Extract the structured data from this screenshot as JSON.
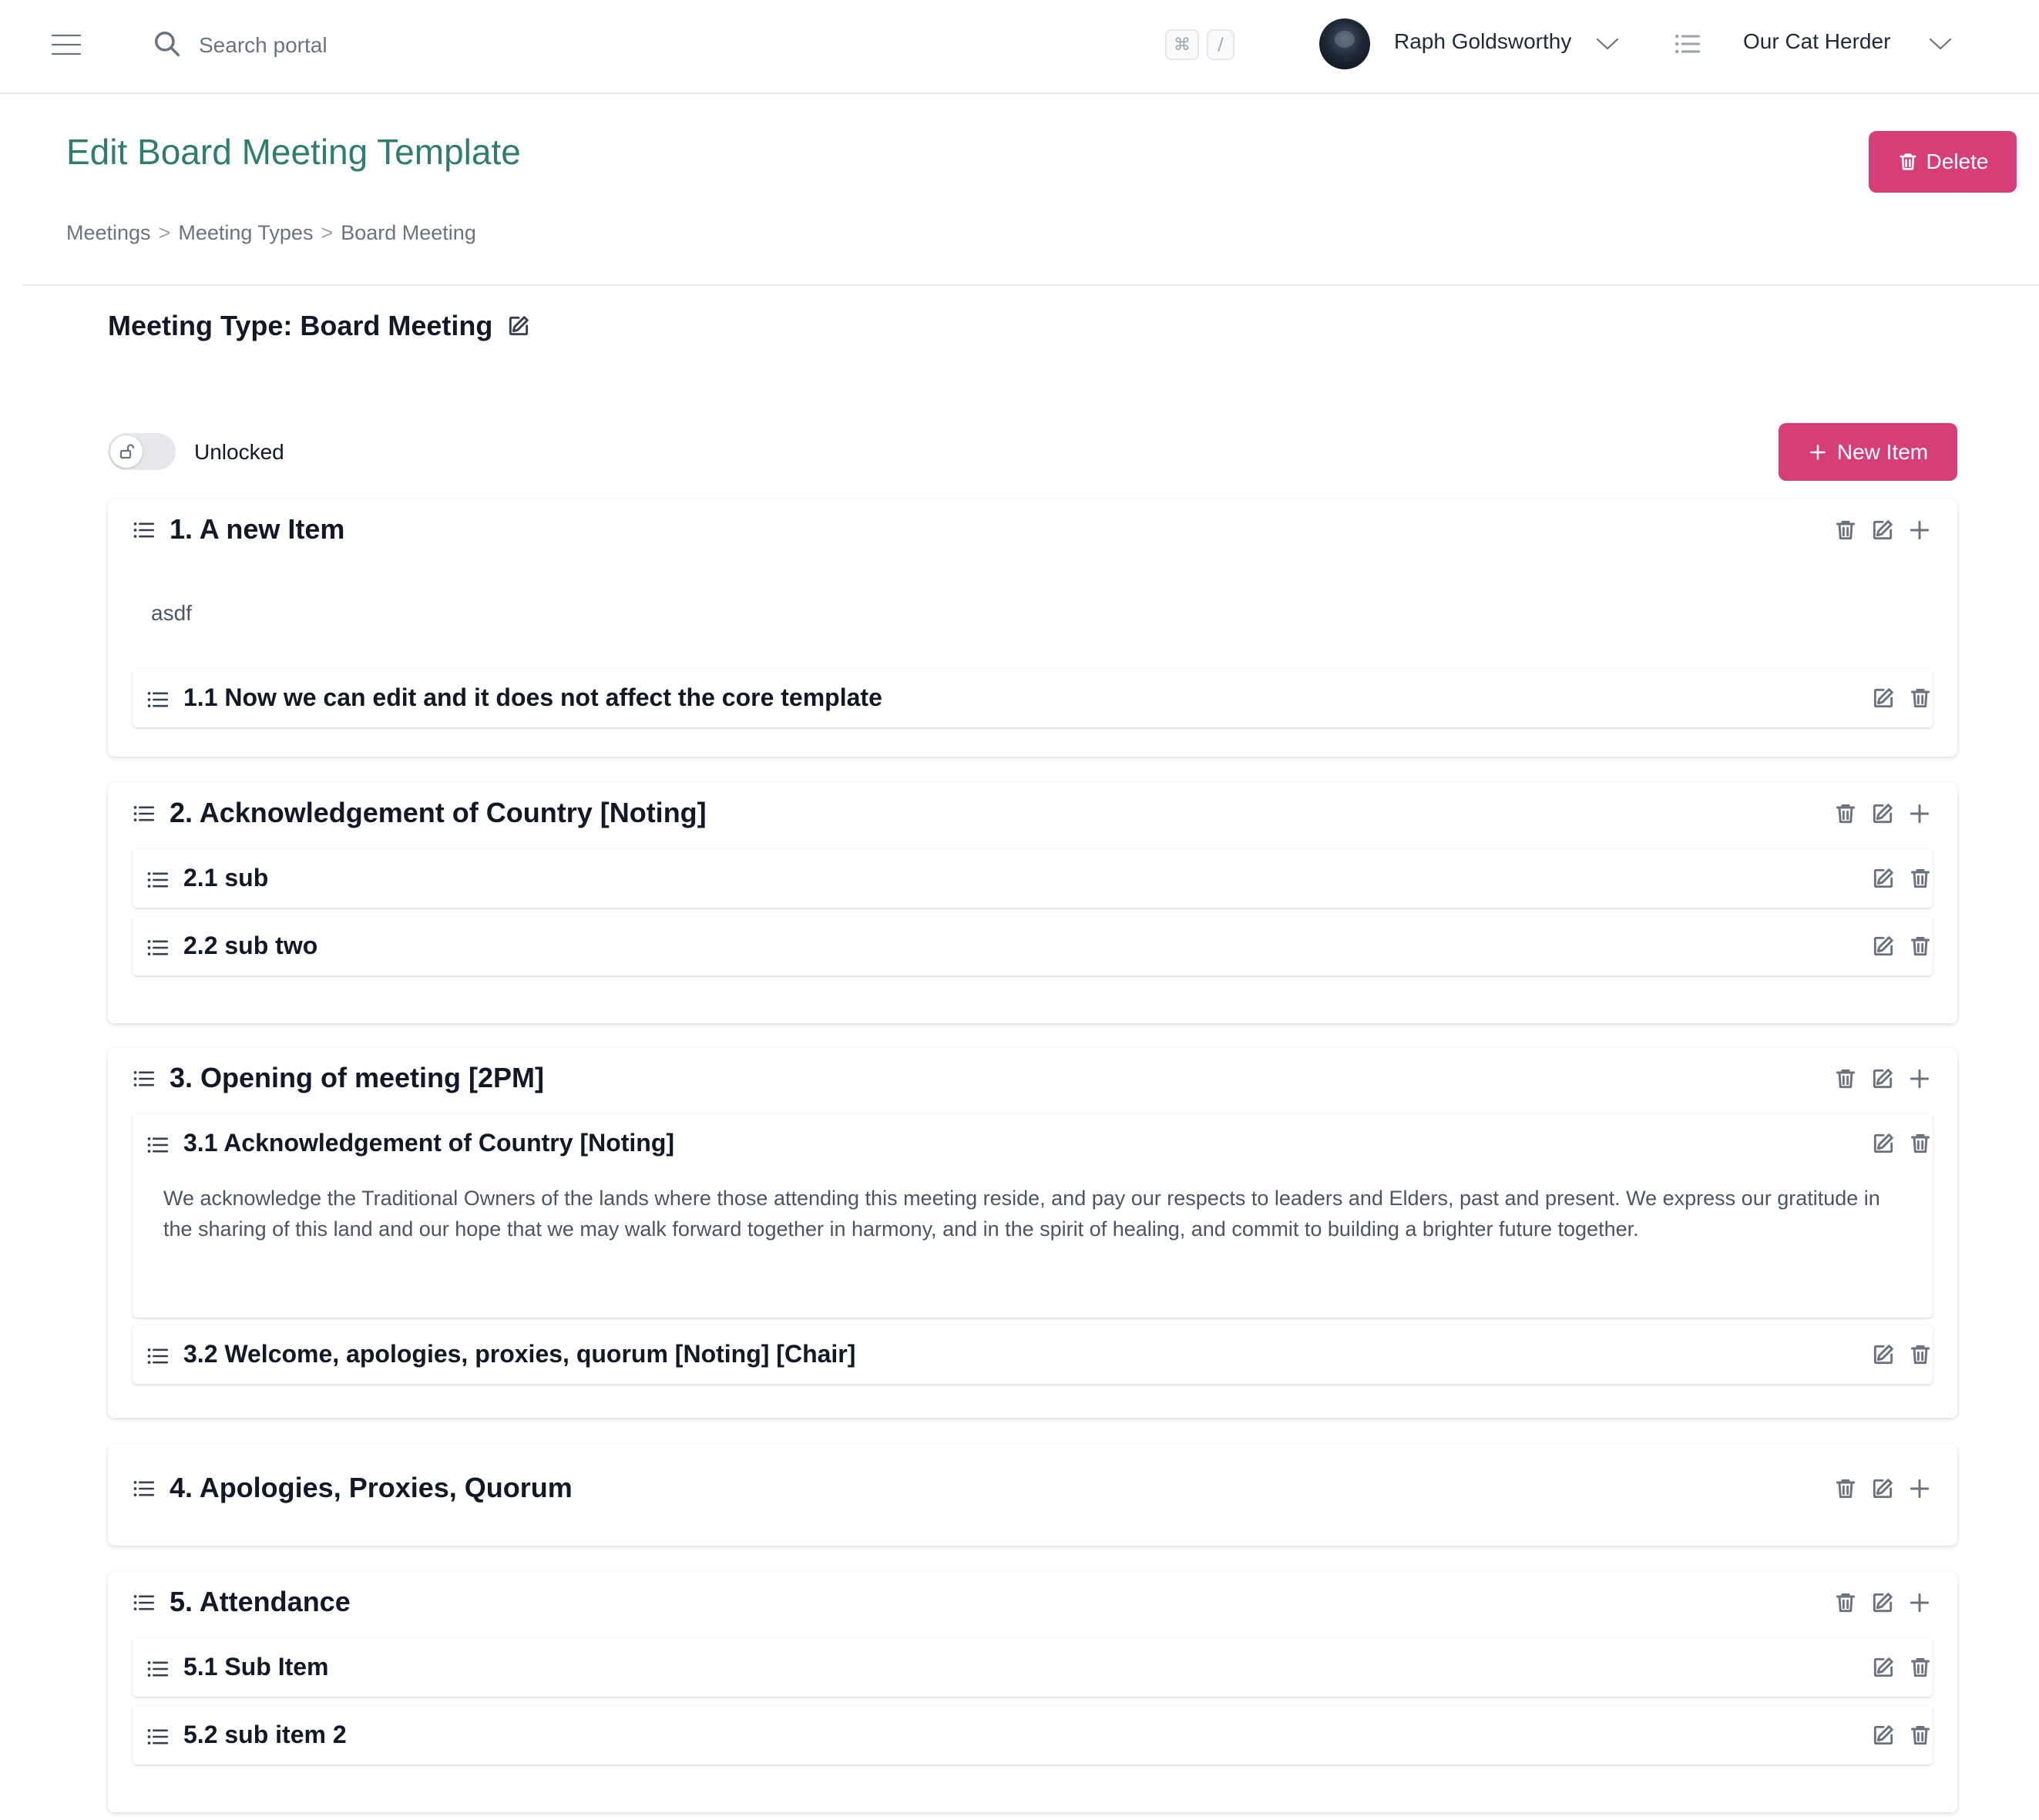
{
  "topbar": {
    "menu_icon": "hamburger-icon",
    "search_icon": "search-icon",
    "search_placeholder": "Search portal",
    "shortcut_cmd": "⌘",
    "shortcut_key": "/",
    "user_name": "Raph Goldsworthy",
    "org_icon": "list-icon",
    "org_name": "Our Cat Herder"
  },
  "page": {
    "title": "Edit Board Meeting Template",
    "delete_label": "Delete",
    "breadcrumb": [
      "Meetings",
      ">",
      "Meeting Types",
      ">",
      "Board Meeting"
    ]
  },
  "meeting_type": {
    "title": "Meeting Type: Board Meeting"
  },
  "toolbar": {
    "lock_state": "Unlocked",
    "locked": false,
    "new_item_label": "New Item"
  },
  "items": [
    {
      "title": "1. A new Item",
      "description": "asdf",
      "subitems": [
        {
          "title": "1.1 Now we can edit and it does not affect the core template",
          "description": ""
        }
      ]
    },
    {
      "title": "2. Acknowledgement of Country [Noting]",
      "description": "",
      "subitems": [
        {
          "title": "2.1 sub",
          "description": ""
        },
        {
          "title": "2.2 sub two",
          "description": ""
        }
      ]
    },
    {
      "title": "3. Opening of meeting [2PM]",
      "description": "",
      "subitems": [
        {
          "title": "3.1 Acknowledgement of Country [Noting]",
          "description": "We acknowledge the Traditional Owners of the lands where those attending this meeting reside, and pay our respects to leaders and Elders, past and present. We express our gratitude in the sharing of this land and our hope that we may walk forward together in harmony, and in the spirit of healing, and commit to building a brighter future together."
        },
        {
          "title": "3.2 Welcome, apologies, proxies, quorum [Noting] [Chair]",
          "description": ""
        }
      ]
    },
    {
      "title": "4. Apologies, Proxies, Quorum",
      "description": "",
      "subitems": []
    },
    {
      "title": "5. Attendance",
      "description": "",
      "subitems": [
        {
          "title": "5.1 Sub Item",
          "description": ""
        },
        {
          "title": "5.2 sub item 2",
          "description": ""
        }
      ]
    }
  ],
  "colors": {
    "accent": "#d63e77",
    "title_green": "#2e7d6f",
    "muted": "#6b7280"
  }
}
